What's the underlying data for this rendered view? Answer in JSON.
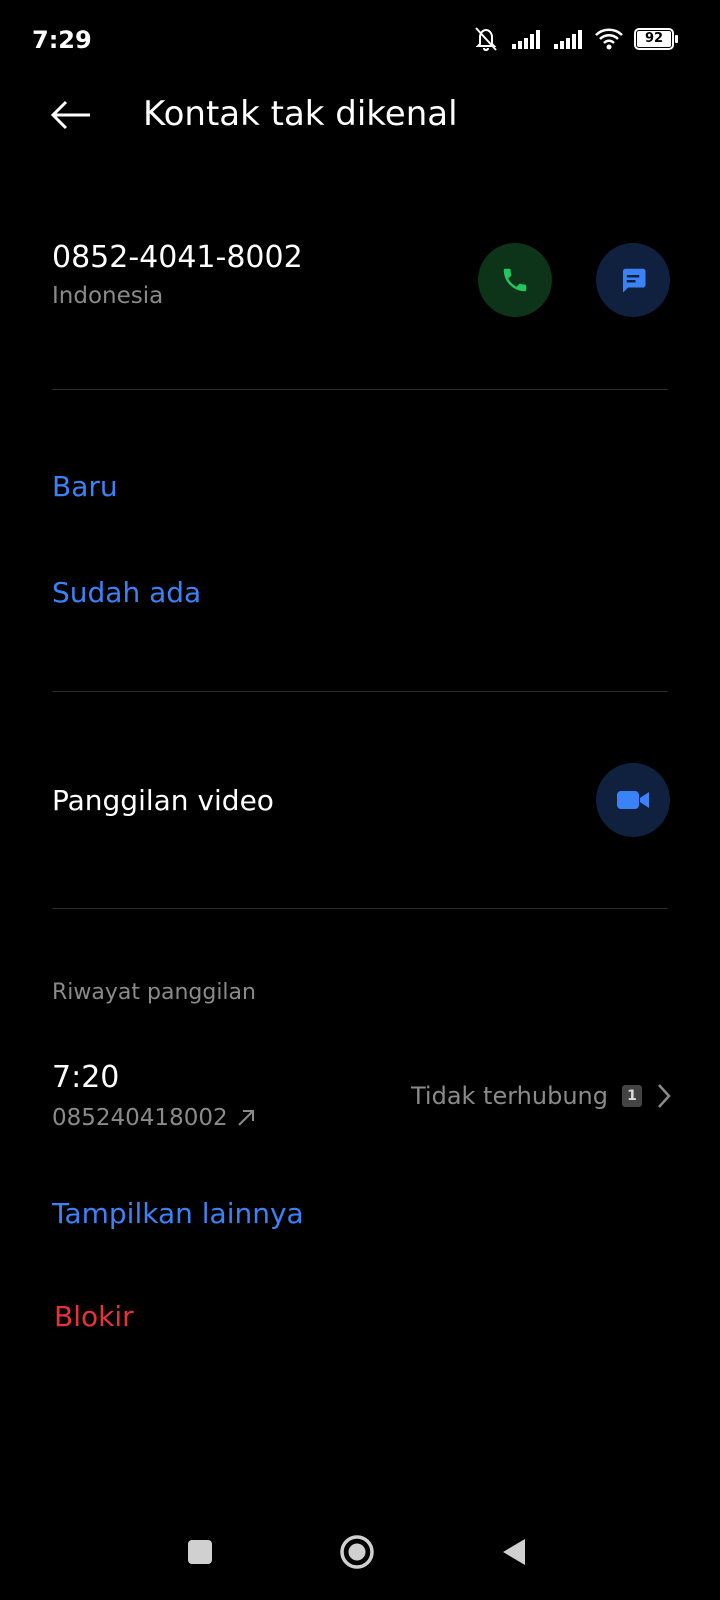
{
  "status_bar": {
    "time": "7:29",
    "battery": "92"
  },
  "header": {
    "title": "Kontak tak dikenal"
  },
  "contact": {
    "phone_number": "0852-4041-8002",
    "country": "Indonesia"
  },
  "add_contact": {
    "new_label": "Baru",
    "existing_label": "Sudah ada"
  },
  "video_call": {
    "label": "Panggilan video"
  },
  "call_history": {
    "section_title": "Riwayat panggilan",
    "entries": [
      {
        "time": "7:20",
        "number": "085240418002",
        "status": "Tidak terhubung",
        "count": "1"
      }
    ],
    "show_more_label": "Tampilkan lainnya"
  },
  "block": {
    "label": "Blokir"
  },
  "colors": {
    "accent_blue": "#3b82f6",
    "call_green": "#22c55e",
    "danger_red": "#e8323a"
  }
}
